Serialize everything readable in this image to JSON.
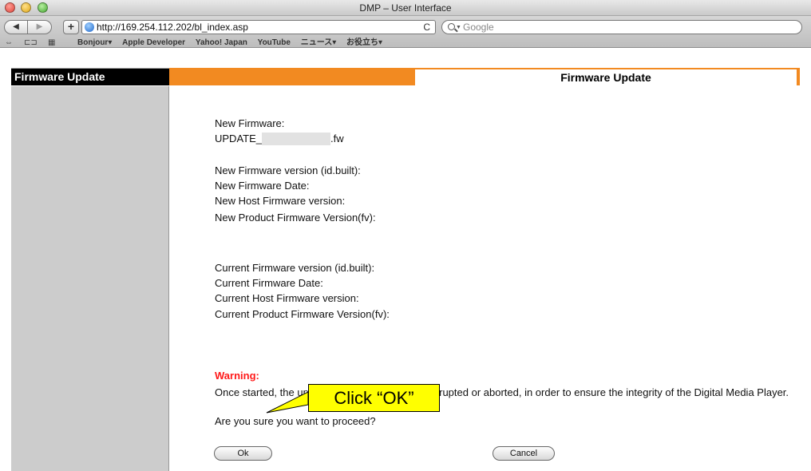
{
  "window": {
    "title": "DMP – User Interface"
  },
  "toolbar": {
    "back": "◀",
    "forward": "▶",
    "add": "+",
    "url": "http://169.254.112.202/bl_index.asp",
    "reload": "C",
    "search_placeholder": "Google"
  },
  "bookmarks": [
    "Bonjour▾",
    "Apple Developer",
    "Yahoo! Japan",
    "YouTube",
    "ニュース▾",
    "お役立ち▾"
  ],
  "sidebar": {
    "header": "Firmware Update"
  },
  "main": {
    "title": "Firmware Update",
    "new_firmware_label": "New Firmware:",
    "file_prefix": "UPDATE_",
    "file_suffix": ".fw",
    "new_version_label": "New Firmware version (id.built):",
    "new_date_label": "New Firmware Date:",
    "new_host_label": "New Host Firmware version:",
    "new_product_label": "New Product Firmware Version(fv):",
    "cur_version_label": "Current Firmware version (id.built):",
    "cur_date_label": "Current Firmware Date:",
    "cur_host_label": "Current Host Firmware version:",
    "cur_product_label": "Current Product Firmware Version(fv):",
    "warning_title": "Warning:",
    "warning_text": "Once started, the upload process cannot be interrupted or aborted, in order to ensure the integrity of the Digital Media Player.",
    "confirm_text": "Are you sure you want to proceed?",
    "ok_label": "Ok",
    "cancel_label": "Cancel"
  },
  "callout": {
    "text": "Click “OK”",
    "color": "#ffff00"
  },
  "colors": {
    "accent": "#f28a21",
    "warning": "#ff1a1a"
  }
}
